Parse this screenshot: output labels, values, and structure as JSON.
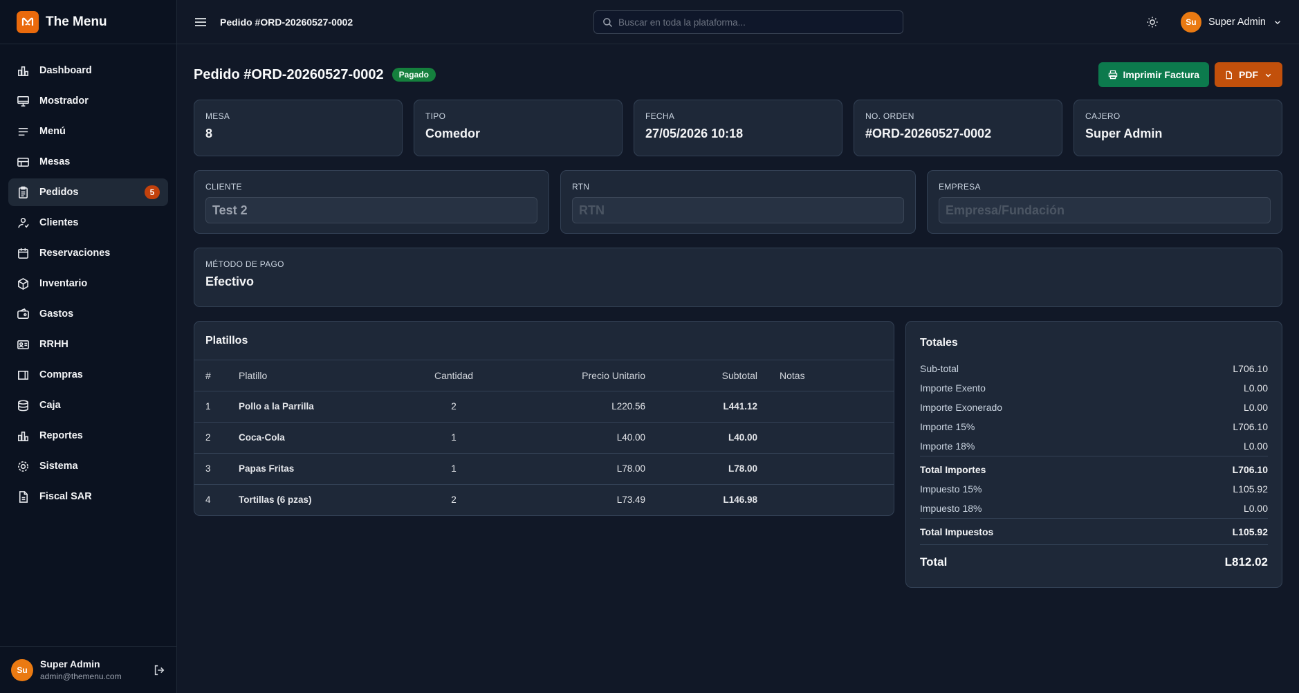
{
  "brand": {
    "name": "The Menu"
  },
  "sidebar": {
    "items": [
      {
        "label": "Dashboard",
        "icon": "bar-chart-icon"
      },
      {
        "label": "Mostrador",
        "icon": "monitor-icon"
      },
      {
        "label": "Menú",
        "icon": "list-icon"
      },
      {
        "label": "Mesas",
        "icon": "table-icon"
      },
      {
        "label": "Pedidos",
        "icon": "clipboard-icon",
        "badge": "5",
        "active": true
      },
      {
        "label": "Clientes",
        "icon": "users-icon"
      },
      {
        "label": "Reservaciones",
        "icon": "calendar-icon"
      },
      {
        "label": "Inventario",
        "icon": "box-icon"
      },
      {
        "label": "Gastos",
        "icon": "wallet-icon"
      },
      {
        "label": "RRHH",
        "icon": "id-card-icon"
      },
      {
        "label": "Compras",
        "icon": "cart-icon"
      },
      {
        "label": "Caja",
        "icon": "database-icon"
      },
      {
        "label": "Reportes",
        "icon": "chart-icon"
      },
      {
        "label": "Sistema",
        "icon": "gear-icon"
      },
      {
        "label": "Fiscal SAR",
        "icon": "file-icon"
      }
    ],
    "user": {
      "initials": "Su",
      "name": "Super Admin",
      "email": "admin@themenu.com"
    }
  },
  "topbar": {
    "title": "Pedido #ORD-20260527-0002",
    "search_placeholder": "Buscar en toda la plataforma...",
    "user_initials": "Su",
    "user_name": "Super Admin"
  },
  "page": {
    "title": "Pedido #ORD-20260527-0002",
    "status": "Pagado",
    "print_label": "Imprimir Factura",
    "pdf_label": "PDF"
  },
  "info": [
    {
      "label": "MESA",
      "value": "8"
    },
    {
      "label": "TIPO",
      "value": "Comedor"
    },
    {
      "label": "FECHA",
      "value": "27/05/2026 10:18"
    },
    {
      "label": "NO. ORDEN",
      "value": "#ORD-20260527-0002"
    },
    {
      "label": "CAJERO",
      "value": "Super Admin"
    }
  ],
  "fields": {
    "cliente": {
      "label": "CLIENTE",
      "value": "Test 2"
    },
    "rtn": {
      "label": "RTN",
      "placeholder": "RTN"
    },
    "empresa": {
      "label": "EMPRESA",
      "placeholder": "Empresa/Fundación"
    }
  },
  "payment": {
    "label": "MÉTODO DE PAGO",
    "value": "Efectivo"
  },
  "dishes": {
    "title": "Platillos",
    "columns": [
      "#",
      "Platillo",
      "Cantidad",
      "Precio Unitario",
      "Subtotal",
      "Notas"
    ],
    "rows": [
      {
        "n": "1",
        "name": "Pollo a la Parrilla",
        "qty": "2",
        "price": "L220.56",
        "subtotal": "L441.12",
        "notes": ""
      },
      {
        "n": "2",
        "name": "Coca-Cola",
        "qty": "1",
        "price": "L40.00",
        "subtotal": "L40.00",
        "notes": ""
      },
      {
        "n": "3",
        "name": "Papas Fritas",
        "qty": "1",
        "price": "L78.00",
        "subtotal": "L78.00",
        "notes": ""
      },
      {
        "n": "4",
        "name": "Tortillas (6 pzas)",
        "qty": "2",
        "price": "L73.49",
        "subtotal": "L146.98",
        "notes": ""
      }
    ]
  },
  "totals": {
    "title": "Totales",
    "subtotal": {
      "label": "Sub-total",
      "value": "L706.10"
    },
    "exento": {
      "label": "Importe Exento",
      "value": "L0.00"
    },
    "exonerado": {
      "label": "Importe Exonerado",
      "value": "L0.00"
    },
    "importe15": {
      "label": "Importe 15%",
      "value": "L706.10"
    },
    "importe18": {
      "label": "Importe 18%",
      "value": "L0.00"
    },
    "total_importes": {
      "label": "Total Importes",
      "value": "L706.10"
    },
    "impuesto15": {
      "label": "Impuesto 15%",
      "value": "L105.92"
    },
    "impuesto18": {
      "label": "Impuesto 18%",
      "value": "L0.00"
    },
    "total_impuestos": {
      "label": "Total Impuestos",
      "value": "L105.92"
    },
    "total": {
      "label": "Total",
      "value": "L812.02"
    }
  },
  "colors": {
    "accent": "#ea6a0c",
    "success": "#0c7a4d",
    "background": "#111827"
  }
}
